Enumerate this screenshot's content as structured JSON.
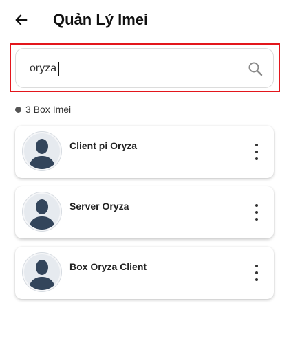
{
  "header": {
    "title": "Quản Lý Imei",
    "back_icon": "arrow-left-icon"
  },
  "search": {
    "value": "oryza",
    "icon": "search-icon"
  },
  "summary": {
    "count_text": "3 Box Imei"
  },
  "items": [
    {
      "name": "Client pi Oryza",
      "avatar_icon": "person-silhouette-icon",
      "menu_icon": "more-vertical-icon"
    },
    {
      "name": "Server Oryza",
      "avatar_icon": "person-silhouette-icon",
      "menu_icon": "more-vertical-icon"
    },
    {
      "name": "Box Oryza Client",
      "avatar_icon": "person-silhouette-icon",
      "menu_icon": "more-vertical-icon"
    }
  ],
  "colors": {
    "highlight_border": "#e3161c",
    "avatar_figure": "#33455b",
    "avatar_bg": "#e6eaef"
  }
}
